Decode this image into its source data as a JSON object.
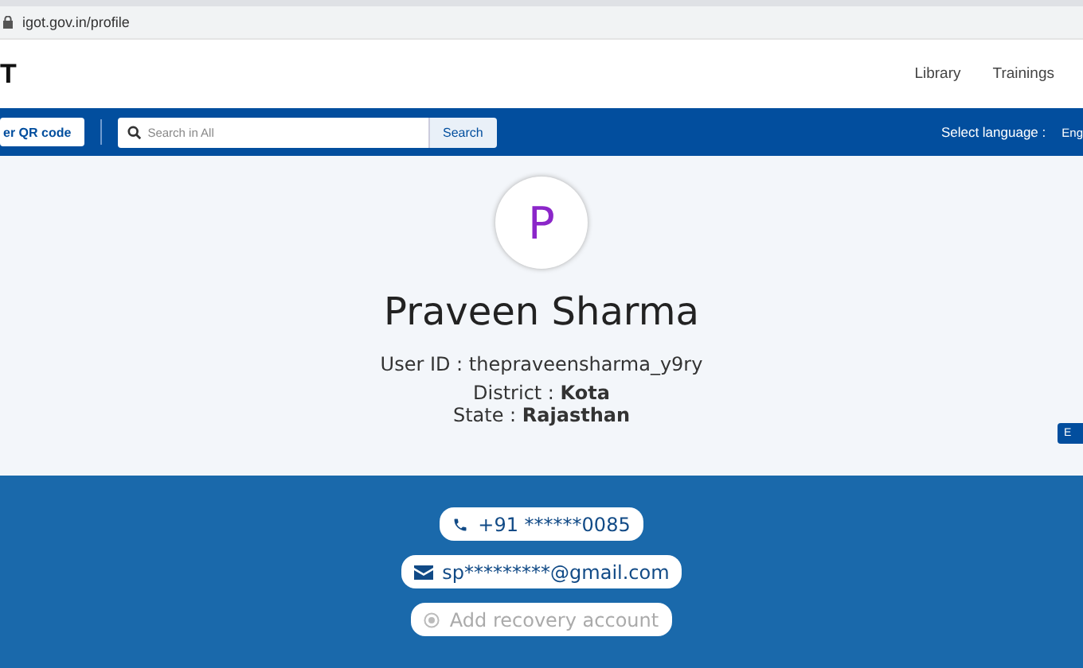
{
  "browser": {
    "url": "igot.gov.in/profile"
  },
  "header": {
    "logo": "T",
    "nav": [
      "Library",
      "Trainings"
    ]
  },
  "toolbar": {
    "qr_button": "er QR code",
    "search": {
      "placeholder": "Search in All",
      "button": "Search"
    },
    "language_label": "Select language :",
    "language_value": "Eng"
  },
  "profile": {
    "initial": "P",
    "name": "Praveen Sharma",
    "user_id": "User ID : thepraveensharma_y9ry",
    "district_label": "District : ",
    "district": "Kota",
    "state_label": "State : ",
    "state": "Rajasthan",
    "side_button": "E"
  },
  "contacts": [
    {
      "kind": "phone",
      "text": "+91 ******0085",
      "disabled": false
    },
    {
      "kind": "email",
      "text": "sp*********@gmail.com",
      "disabled": false
    },
    {
      "kind": "recovery",
      "text": "Add recovery account",
      "disabled": true
    }
  ]
}
